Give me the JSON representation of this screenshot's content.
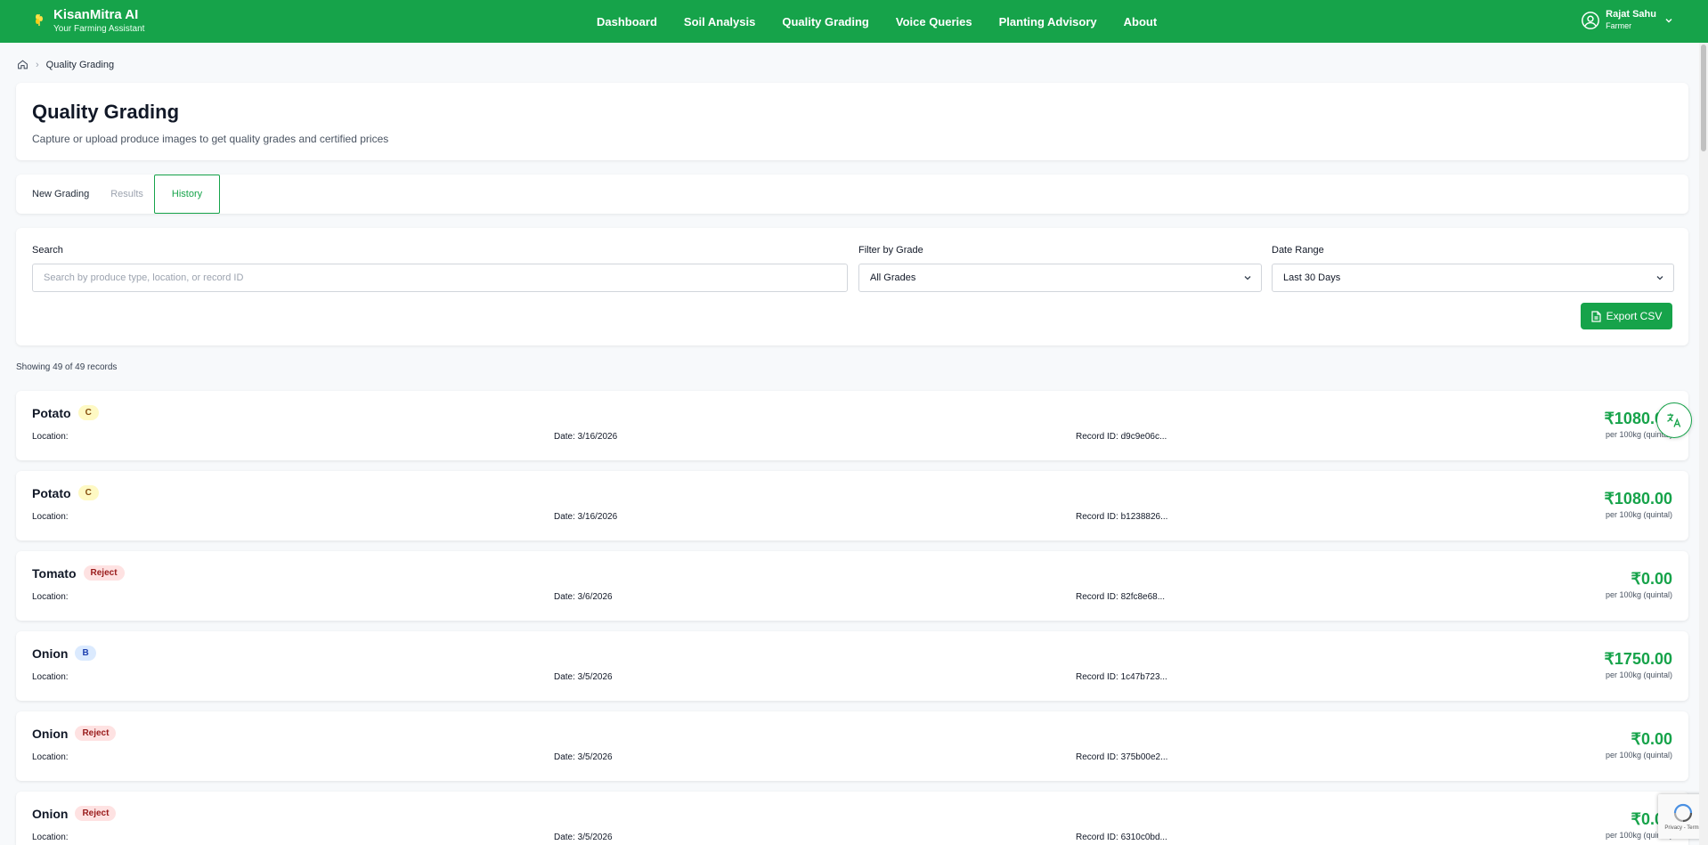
{
  "header": {
    "brand_title": "KisanMitra AI",
    "brand_sub": "Your Farming Assistant",
    "nav": [
      "Dashboard",
      "Soil Analysis",
      "Quality Grading",
      "Voice Queries",
      "Planting Advisory",
      "About"
    ],
    "user_name": "Rajat Sahu",
    "user_role": "Farmer"
  },
  "breadcrumb": {
    "current": "Quality Grading"
  },
  "page": {
    "title": "Quality Grading",
    "subtitle": "Capture or upload produce images to get quality grades and certified prices"
  },
  "tabs": [
    "New Grading",
    "Results",
    "History"
  ],
  "filters": {
    "search_label": "Search",
    "search_placeholder": "Search by produce type, location, or record ID",
    "grade_label": "Filter by Grade",
    "grade_value": "All Grades",
    "date_label": "Date Range",
    "date_value": "Last 30 Days",
    "export_label": "Export CSV"
  },
  "showing": "Showing 49 of 49 records",
  "records": [
    {
      "name": "Potato",
      "grade": "C",
      "location": "Location:",
      "date": "Date: 3/16/2026",
      "id": "Record ID: d9c9e06c...",
      "price": "₹1080.00",
      "unit": "per 100kg (quintal)"
    },
    {
      "name": "Potato",
      "grade": "C",
      "location": "Location:",
      "date": "Date: 3/16/2026",
      "id": "Record ID: b1238826...",
      "price": "₹1080.00",
      "unit": "per 100kg (quintal)"
    },
    {
      "name": "Tomato",
      "grade": "Reject",
      "location": "Location:",
      "date": "Date: 3/6/2026",
      "id": "Record ID: 82fc8e68...",
      "price": "₹0.00",
      "unit": "per 100kg (quintal)"
    },
    {
      "name": "Onion",
      "grade": "B",
      "location": "Location:",
      "date": "Date: 3/5/2026",
      "id": "Record ID: 1c47b723...",
      "price": "₹1750.00",
      "unit": "per 100kg (quintal)"
    },
    {
      "name": "Onion",
      "grade": "Reject",
      "location": "Location:",
      "date": "Date: 3/5/2026",
      "id": "Record ID: 375b00e2...",
      "price": "₹0.00",
      "unit": "per 100kg (quintal)"
    },
    {
      "name": "Onion",
      "grade": "Reject",
      "location": "Location:",
      "date": "Date: 3/5/2026",
      "id": "Record ID: 6310c0bd...",
      "price": "₹0.00",
      "unit": "per 100kg (quintal)"
    }
  ],
  "recaptcha": {
    "text": "Privacy - Terms"
  },
  "colors": {
    "brand": "#16a34a",
    "grade_c": "#fef9c3",
    "grade_b": "#dbeafe",
    "grade_reject": "#fee2e2"
  },
  "icons": [
    "wheat-icon",
    "home-icon",
    "chevron-right-icon",
    "user-circle-icon",
    "chevron-down-icon",
    "file-icon",
    "translate-icon",
    "recaptcha-icon"
  ]
}
